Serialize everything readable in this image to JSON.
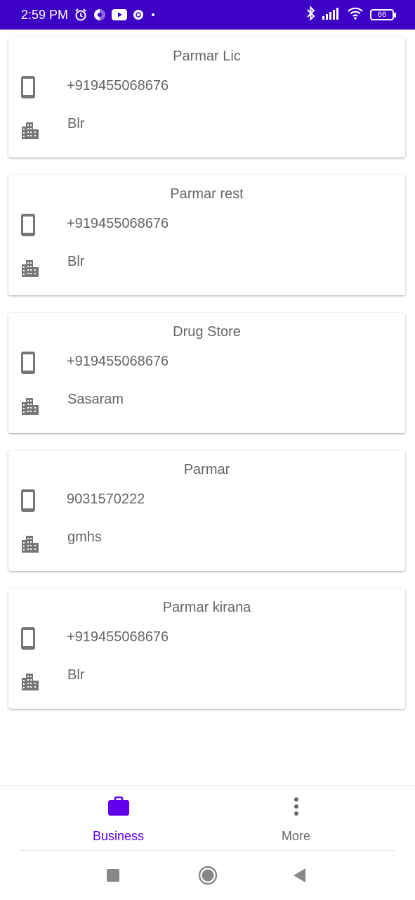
{
  "status_bar": {
    "time": "2:59 PM",
    "battery": "66",
    "left_icons": [
      "alarm-icon",
      "app-notification-icon",
      "youtube-icon",
      "misc-notification-icon",
      "dot-icon"
    ],
    "right_icons": [
      "bluetooth-icon",
      "signal-icon",
      "wifi-icon",
      "battery-icon"
    ]
  },
  "contacts": [
    {
      "name": "Parmar Lic",
      "phone": "+919455068676",
      "city": "Blr"
    },
    {
      "name": "Parmar rest",
      "phone": "+919455068676",
      "city": "Blr"
    },
    {
      "name": "Drug Store",
      "phone": "+919455068676",
      "city": "Sasaram"
    },
    {
      "name": "Parmar",
      "phone": "9031570222",
      "city": "gmhs"
    },
    {
      "name": "Parmar kirana",
      "phone": "+919455068676",
      "city": "Blr"
    }
  ],
  "bottom_nav": {
    "business_label": "Business",
    "more_label": "More",
    "active": "Business"
  },
  "colors": {
    "status_bar": "#3d00c4",
    "accent": "#6200ee",
    "text_gray": "#666666",
    "icon_gray": "#777777"
  }
}
